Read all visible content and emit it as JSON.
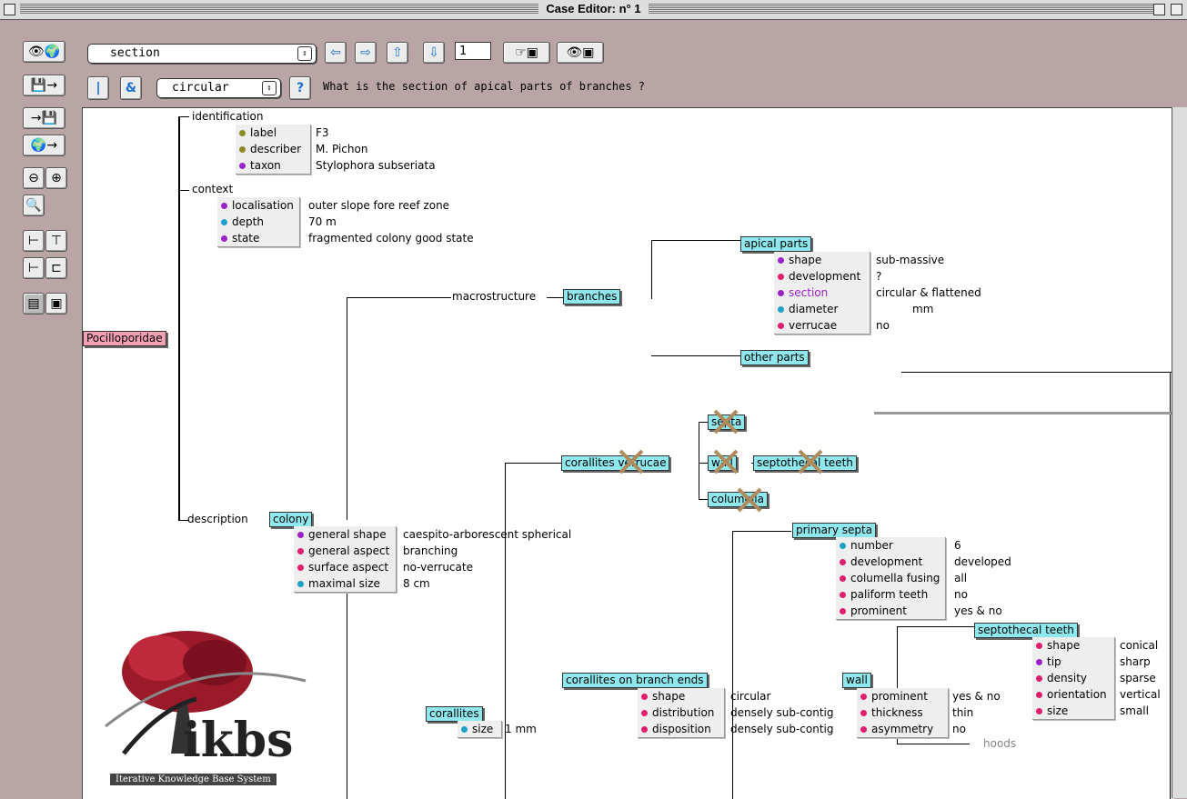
{
  "window": {
    "title": "Case Editor: n° 1"
  },
  "toolbar": {
    "attribute_select": "section",
    "value_select": "circular",
    "step_field": "1",
    "question": "What is the section of apical parts of branches ?"
  },
  "colors": {
    "cyan_node": "#8ee8ee",
    "pink_node": "#f4a0b4",
    "dot_olive": "#8a8a20",
    "dot_purple": "#9b22c8",
    "dot_cyan": "#1ea0c8",
    "dot_pink": "#e01e6e"
  },
  "tree": {
    "root": "Pocilloporidae",
    "identification": {
      "label": "identification",
      "rows": [
        {
          "key": "label",
          "value": "F3"
        },
        {
          "key": "describer",
          "value": "M. Pichon"
        },
        {
          "key": "taxon",
          "value": "Stylophora subseriata"
        }
      ]
    },
    "context": {
      "label": "context",
      "rows": [
        {
          "key": "localisation",
          "value": "outer slope fore reef zone"
        },
        {
          "key": "depth",
          "value": "70 m"
        },
        {
          "key": "state",
          "value": "fragmented colony good state"
        }
      ]
    },
    "description": {
      "label": "description"
    },
    "colony": {
      "label": "colony",
      "rows": [
        {
          "key": "general shape",
          "value": "caespito-arborescent spherical"
        },
        {
          "key": "general aspect",
          "value": "branching"
        },
        {
          "key": "surface aspect",
          "value": "no-verrucate"
        },
        {
          "key": "maximal size",
          "value": "8 cm"
        }
      ]
    },
    "macrostructure": "macrostructure",
    "branches": "branches",
    "apical_parts": {
      "label": "apical parts",
      "rows": [
        {
          "key": "shape",
          "value": "sub-massive"
        },
        {
          "key": "development",
          "value": "?"
        },
        {
          "key": "section",
          "value": "circular & flattened"
        },
        {
          "key": "diameter",
          "value": "mm"
        },
        {
          "key": "verrucae",
          "value": "no"
        }
      ]
    },
    "other_parts": "other parts",
    "corallites_verrucae": "corallites verrucae",
    "septa": "septa",
    "wall": "wall",
    "columella": "columella",
    "septothecal_teeth": "septothecal teeth",
    "primary_septa": {
      "label": "primary septa",
      "rows": [
        {
          "key": "number",
          "value": "6"
        },
        {
          "key": "development",
          "value": "developed"
        },
        {
          "key": "columella fusing",
          "value": "all"
        },
        {
          "key": "paliform teeth",
          "value": "no"
        },
        {
          "key": "prominent",
          "value": "yes & no"
        }
      ]
    },
    "septothecal_teeth_box": {
      "label": "septothecal teeth",
      "rows": [
        {
          "key": "shape",
          "value": "conical"
        },
        {
          "key": "tip",
          "value": "sharp"
        },
        {
          "key": "density",
          "value": "sparse"
        },
        {
          "key": "orientation",
          "value": "vertical"
        },
        {
          "key": "size",
          "value": "small"
        }
      ]
    },
    "corallites_branch_ends": {
      "label": "corallites on branch ends",
      "rows": [
        {
          "key": "shape",
          "value": "circular"
        },
        {
          "key": "distribution",
          "value": "densely sub-contig"
        },
        {
          "key": "disposition",
          "value": "densely sub-contig"
        }
      ]
    },
    "wall_box": {
      "label": "wall",
      "rows": [
        {
          "key": "prominent",
          "value": "yes & no"
        },
        {
          "key": "thickness",
          "value": "thin"
        },
        {
          "key": "asymmetry",
          "value": "no"
        }
      ]
    },
    "hoods": "hoods",
    "corallites": {
      "label": "corallites",
      "rows": [
        {
          "key": "size",
          "value": "1 mm"
        }
      ]
    }
  },
  "logo": {
    "name": "ikbs",
    "tagline": "Iterative Knowledge Base System"
  }
}
